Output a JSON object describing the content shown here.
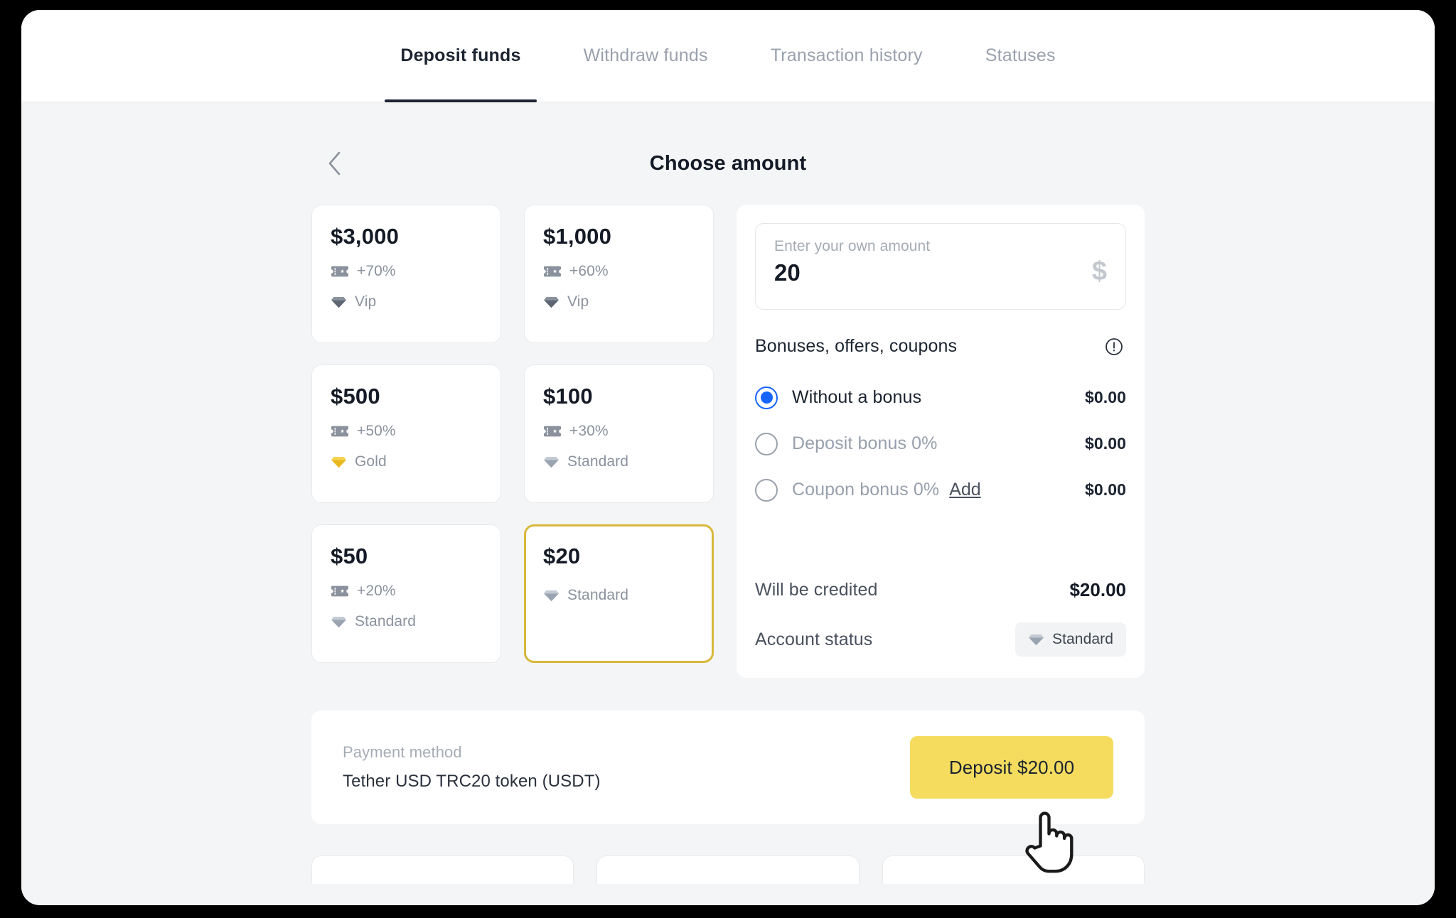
{
  "tabs": [
    {
      "label": "Deposit funds",
      "active": true
    },
    {
      "label": "Withdraw funds",
      "active": false
    },
    {
      "label": "Transaction history",
      "active": false
    },
    {
      "label": "Statuses",
      "active": false
    }
  ],
  "header": {
    "title": "Choose amount",
    "back_icon": "chevron-left-icon"
  },
  "amounts": [
    {
      "value": "$3,000",
      "bonus": "+70%",
      "status": "Vip",
      "tier": "vip",
      "selected": false
    },
    {
      "value": "$1,000",
      "bonus": "+60%",
      "status": "Vip",
      "tier": "vip",
      "selected": false
    },
    {
      "value": "$500",
      "bonus": "+50%",
      "status": "Gold",
      "tier": "gold",
      "selected": false
    },
    {
      "value": "$100",
      "bonus": "+30%",
      "status": "Standard",
      "tier": "standard",
      "selected": false
    },
    {
      "value": "$50",
      "bonus": "+20%",
      "status": "Standard",
      "tier": "standard",
      "selected": false
    },
    {
      "value": "$20",
      "bonus": "",
      "status": "Standard",
      "tier": "standard",
      "selected": true
    }
  ],
  "amount_input": {
    "placeholder": "Enter your own amount",
    "value": "20",
    "currency_symbol": "$"
  },
  "bonuses": {
    "title": "Bonuses, offers, coupons",
    "info_icon": "info-exclamation-icon",
    "options": [
      {
        "label": "Without a bonus",
        "amount": "$0.00",
        "selected": true,
        "link": ""
      },
      {
        "label": "Deposit bonus 0%",
        "amount": "$0.00",
        "selected": false,
        "link": ""
      },
      {
        "label": "Coupon bonus 0%",
        "amount": "$0.00",
        "selected": false,
        "link": "Add"
      }
    ]
  },
  "summary": {
    "credited_label": "Will be credited",
    "credited_value": "$20.00",
    "status_label": "Account status",
    "status_value": "Standard"
  },
  "payment": {
    "label": "Payment method",
    "method": "Tether USD TRC20 token (USDT)",
    "deposit_button": "Deposit $20.00"
  },
  "colors": {
    "accent_yellow": "#F5DC5F",
    "selected_border": "#D8B83C",
    "radio_blue": "#1665FF",
    "gold": "#F2C744",
    "text_dark": "#141B26",
    "text_muted": "#97A0AC"
  }
}
